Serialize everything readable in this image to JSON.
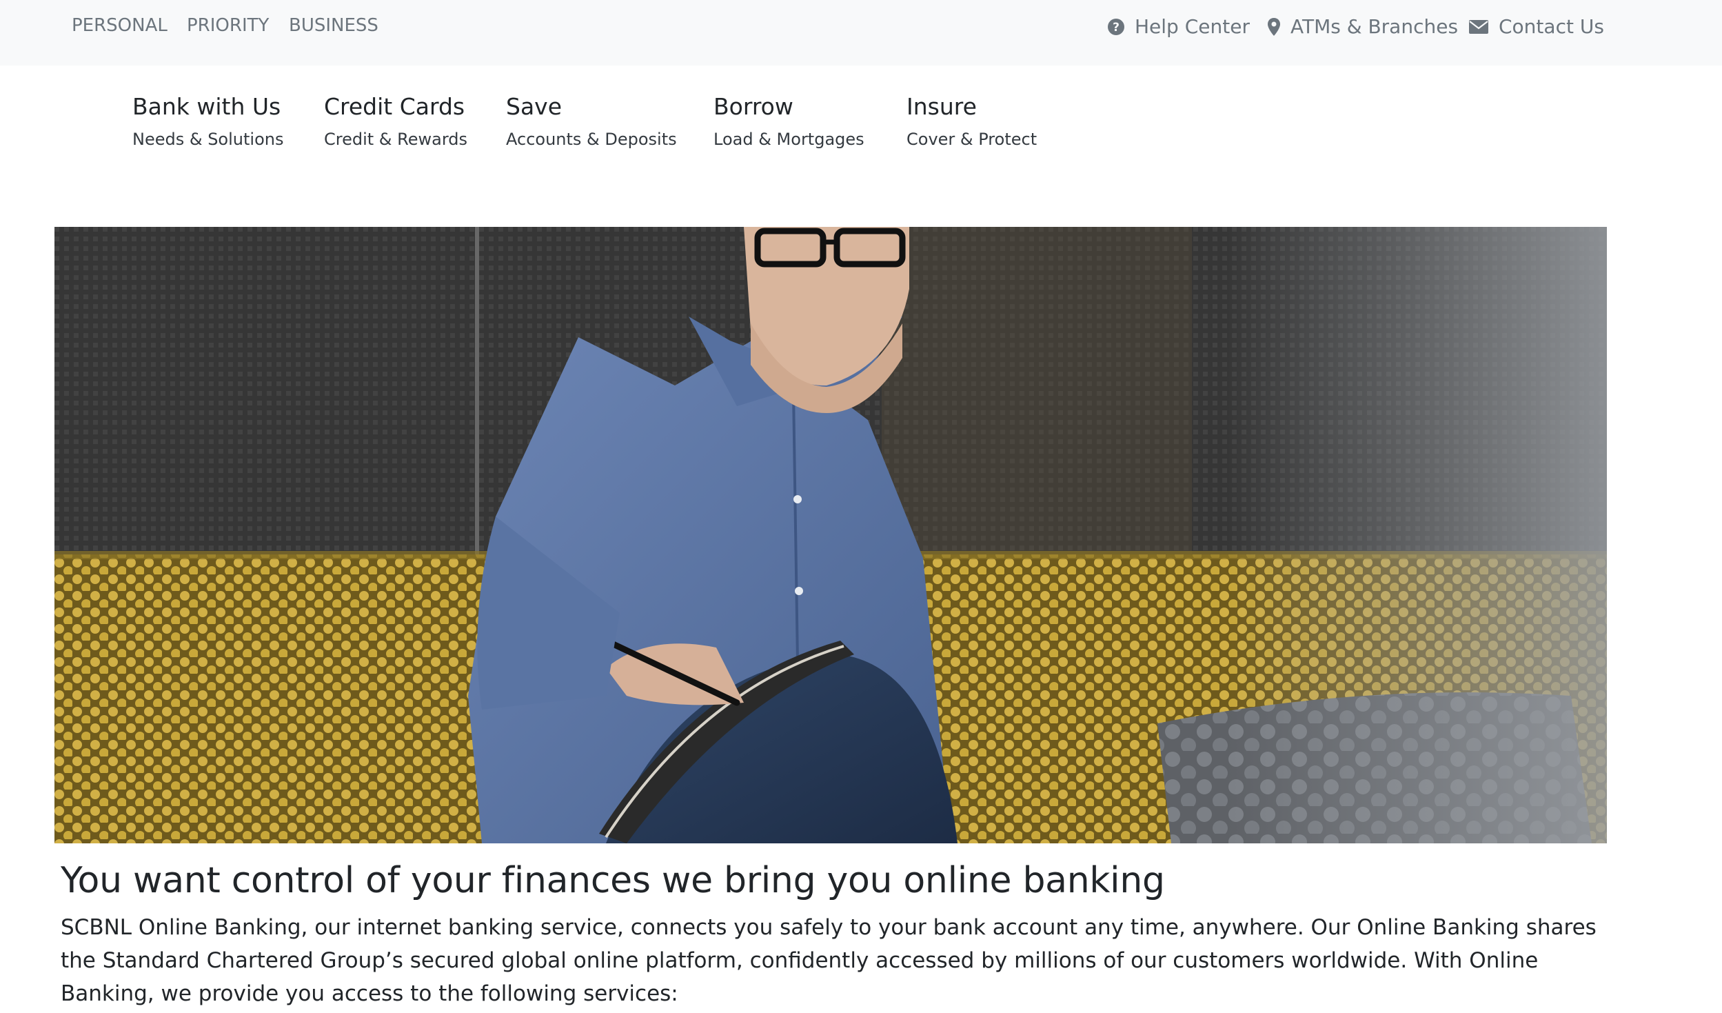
{
  "topbar": {
    "segments": [
      {
        "label": "PERSONAL"
      },
      {
        "label": "PRIORITY"
      },
      {
        "label": "BUSINESS"
      }
    ],
    "utility": [
      {
        "label": "Help Center",
        "icon": "question-circle-icon"
      },
      {
        "label": "ATMs & Branches",
        "icon": "map-marker-icon"
      },
      {
        "label": "Contact Us",
        "icon": "envelope-icon"
      }
    ]
  },
  "mainnav": {
    "items": [
      {
        "title": "Bank with Us",
        "subtitle": "Needs & Solutions"
      },
      {
        "title": "Credit Cards",
        "subtitle": "Credit & Rewards"
      },
      {
        "title": "Save",
        "subtitle": "Accounts & Deposits"
      },
      {
        "title": "Borrow",
        "subtitle": "Load & Mortgages"
      },
      {
        "title": "Insure",
        "subtitle": "Cover & Protect"
      }
    ]
  },
  "content": {
    "headline": "You want control of your finances we bring you online banking",
    "intro": "SCBNL Online Banking, our internet banking service, connects you safely to your bank account any time, anywhere. Our Online Banking shares the Standard Chartered Group’s secured global online platform, confidently accessed by millions of our customers worldwide. With Online Banking, we provide you access to the following services:"
  },
  "colors": {
    "topbar_bg": "#f8f9fa",
    "muted_text": "#6c757d",
    "body_text": "#212529",
    "sofa_yellow": "#c9a83a",
    "shirt_blue": "#5a74a3"
  }
}
